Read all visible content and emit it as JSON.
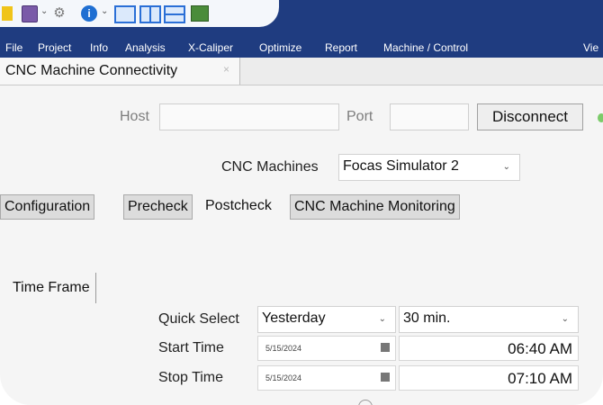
{
  "menu": [
    "File",
    "Project",
    "Info",
    "Analysis",
    "X-Caliper",
    "Optimize",
    "Report",
    "Machine / Control",
    "Vie"
  ],
  "toolbar": {
    "icons": [
      "quick-access-icon",
      "document-icon",
      "chevron-down-icon",
      "tools-icon",
      "info-icon",
      "single-pane-layout-icon",
      "split-vertical-layout-icon",
      "split-horizontal-layout-icon",
      "image-icon"
    ],
    "info_glyph": "i"
  },
  "doc_tab": {
    "label": "CNC Machine Connectivity",
    "close": "×"
  },
  "connection": {
    "host_label": "Host",
    "host_value": "",
    "port_label": "Port",
    "port_value": "",
    "disconnect_label": "Disconnect"
  },
  "machines": {
    "label": "CNC Machines",
    "selected": "Focas Simulator 2"
  },
  "subtabs": [
    "Configuration",
    "Precheck",
    "Postcheck",
    "CNC Machine Monitoring"
  ],
  "active_subtab": "Postcheck",
  "time_frame": {
    "tab_label": "Time Frame",
    "quick_select_label": "Quick Select",
    "quick_select_value": "Yesterday",
    "interval_value": "30 min.",
    "start_label": "Start Time",
    "start_date": "5/15/2024",
    "start_time": "06:40 AM",
    "stop_label": "Stop Time",
    "stop_date": "5/15/2024",
    "stop_time": "07:10 AM"
  },
  "colors": {
    "menubar": "#1f3c80",
    "status_connected": "#7ccb6a"
  }
}
